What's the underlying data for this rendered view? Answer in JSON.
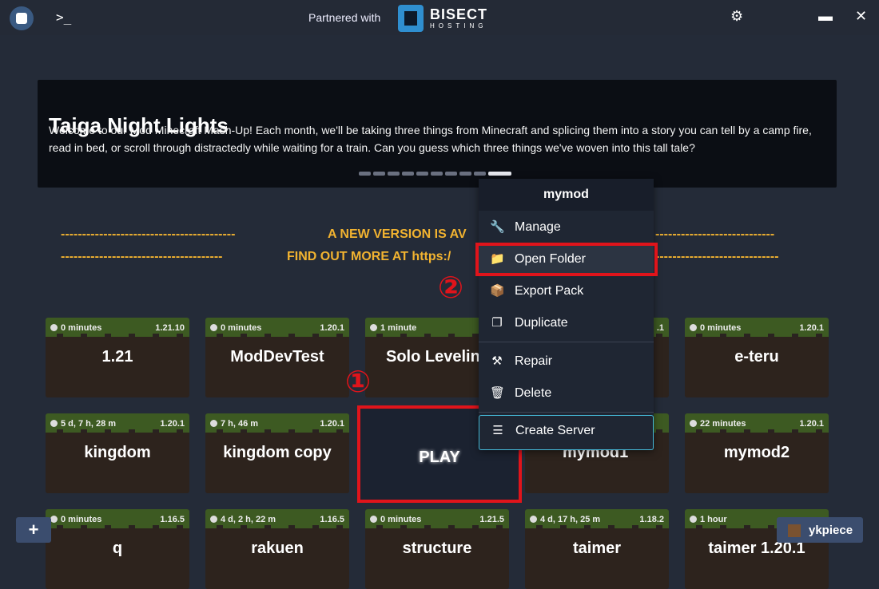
{
  "titlebar": {
    "partner_text": "Partnered with",
    "brand_top": "BISECT",
    "brand_bottom": "HOSTING",
    "terminal_glyph": ">_",
    "icons": [
      "app-logo-icon",
      "terminal-icon",
      "settings-icon",
      "maximize-icon",
      "close-icon"
    ]
  },
  "banner": {
    "title": "Taiga Night Lights",
    "description": "Welcome to our Mod Minecraft Mash-Up! Each month, we'll be taking three things from Minecraft and splicing them into a story you can tell by a camp fire, read in bed, or scroll through distractedly while waiting for a train. Can you guess which three things we've woven into this tall tale?",
    "slide_count": 10,
    "active_slide": 10
  },
  "notice": {
    "line1_dashes_left": "-----------------------------------------",
    "line1_text": "A NEW VERSION IS AV",
    "line1_dashes_right": "----------------------------",
    "line2_dashes_left": "--------------------------------------",
    "line2_text": "FIND OUT MORE AT https:/",
    "line2_dashes_right": "-----------------------------"
  },
  "instances": [
    {
      "name": "1.21",
      "time": "0 minutes",
      "version": "1.21.10"
    },
    {
      "name": "ModDevTest",
      "time": "0 minutes",
      "version": "1.20.1"
    },
    {
      "name": "Solo Levelin",
      "time": "1 minute",
      "version": ""
    },
    {
      "name": "",
      "time": "",
      "version": ".1"
    },
    {
      "name": "e-teru",
      "time": "0 minutes",
      "version": "1.20.1"
    },
    {
      "name": "kingdom",
      "time": "5 d, 7 h, 28 m",
      "version": "1.20.1"
    },
    {
      "name": "kingdom copy",
      "time": "7 h, 46 m",
      "version": "1.20.1"
    },
    {
      "name": "mymod1",
      "time": "",
      "version": ""
    },
    {
      "name": "mymod2",
      "time": "22 minutes",
      "version": "1.20.1"
    },
    {
      "name": "q",
      "time": "0 minutes",
      "version": "1.16.5"
    },
    {
      "name": "rakuen",
      "time": "4 d, 2 h, 22 m",
      "version": "1.16.5"
    },
    {
      "name": "structure",
      "time": "0 minutes",
      "version": "1.21.5"
    },
    {
      "name": "taimer",
      "time": "4 d, 17 h, 25 m",
      "version": "1.18.2"
    },
    {
      "name": "taimer 1.20.1",
      "time": "1 hour",
      "version": ""
    }
  ],
  "play_tile": {
    "label": "PLAY"
  },
  "annotations": {
    "step1": "①",
    "step2": "②",
    "highlight_color": "#e0141b"
  },
  "context_menu": {
    "header": "mymod",
    "items": [
      {
        "label": "Manage",
        "icon": "wrench-icon"
      },
      {
        "label": "Open Folder",
        "icon": "folder-icon"
      },
      {
        "label": "Export Pack",
        "icon": "box-icon"
      },
      {
        "label": "Duplicate",
        "icon": "copy-icon"
      },
      {
        "label": "Repair",
        "icon": "hammer-icon"
      },
      {
        "label": "Delete",
        "icon": "trash-icon"
      },
      {
        "label": "Create Server",
        "icon": "server-icon"
      }
    ]
  },
  "footer": {
    "add_label": "+",
    "username": "ykpiece"
  }
}
